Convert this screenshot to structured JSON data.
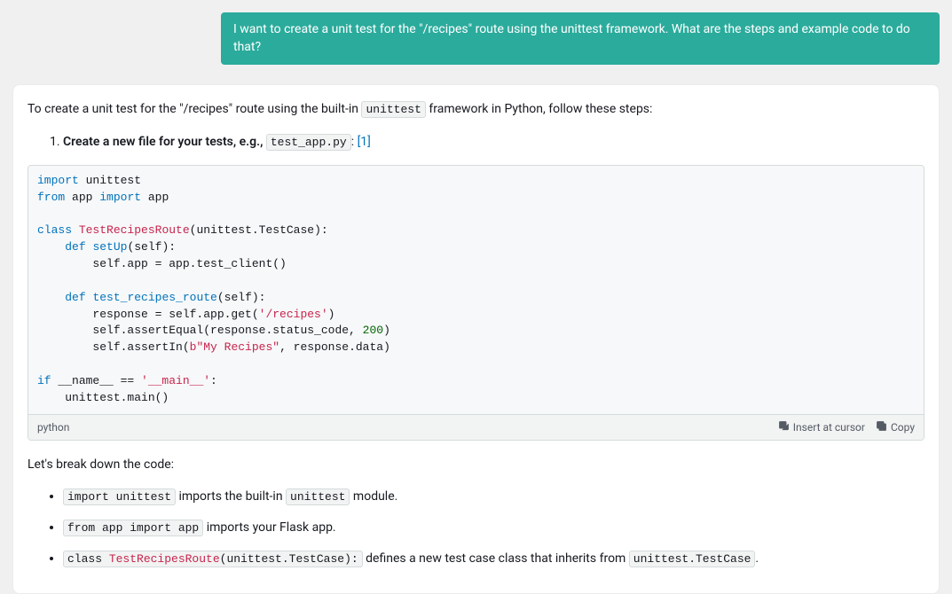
{
  "user_message": "I want to create a unit test for the \"/recipes\" route using the unittest framework. What are the steps and example code to do that?",
  "response": {
    "intro_before_code": "To create a unit test for the \"/recipes\" route using the built-in ",
    "intro_inline_code": "unittest",
    "intro_after_code": " framework in Python, follow these steps:",
    "step1_bold": "Create a new file for your tests, e.g.,",
    "step1_code": "test_app.py",
    "step1_colon": ":",
    "step1_ref": "[1]",
    "code_lang": "python",
    "action_insert": "Insert at cursor",
    "action_copy": "Copy",
    "breakdown_intro": "Let's break down the code:",
    "b1_code": "import unittest",
    "b1_text_before": " imports the built-in ",
    "b1_inline": "unittest",
    "b1_text_after": " module.",
    "b2_code": "from app import app",
    "b2_text": " imports your Flask app.",
    "b3_code_prefix": "class ",
    "b3_code_cls": "TestRecipesRoute",
    "b3_code_suffix": "(unittest.TestCase):",
    "b3_text_before": " defines a new test case class that inherits from ",
    "b3_inline": "unittest.TestCase",
    "b3_text_after": "."
  },
  "code": {
    "l1_kw": "import",
    "l1_rest": " unittest",
    "l2_kw1": "from",
    "l2_mid": " app ",
    "l2_kw2": "import",
    "l2_rest": " app",
    "l3_kw": "class",
    "l3_sp": " ",
    "l3_cls": "TestRecipesRoute",
    "l3_rest": "(unittest.TestCase):",
    "l4_indent": "    ",
    "l4_kw": "def",
    "l4_sp": " ",
    "l4_fn": "setUp",
    "l4_rest": "(self):",
    "l5": "        self.app = app.test_client()",
    "l6_indent": "    ",
    "l6_kw": "def",
    "l6_sp": " ",
    "l6_fn": "test_recipes_route",
    "l6_rest": "(self):",
    "l7_before": "        response = self.app.get(",
    "l7_str": "'/recipes'",
    "l7_after": ")",
    "l8_before": "        self.assertEqual(response.status_code, ",
    "l8_num": "200",
    "l8_after": ")",
    "l9_before": "        self.assertIn(",
    "l9_str": "b\"My Recipes\"",
    "l9_after": ", response.data)",
    "l10_kw": "if",
    "l10_mid": " __name__ == ",
    "l10_str": "'__main__'",
    "l10_after": ":",
    "l11": "    unittest.main()"
  }
}
